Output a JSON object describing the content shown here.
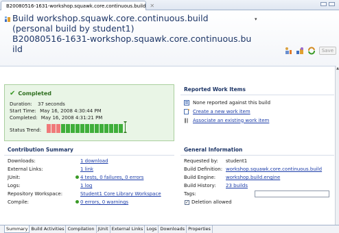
{
  "editor_tab": {
    "label": "B20080516-1631-workshop.squawk.core.continuous.build",
    "close_glyph": "✕"
  },
  "header": {
    "title_line1": "Build workshop.squawk.core.continuous.build",
    "title_line2": "(personal build by student1)",
    "title_line3": "B20080516-1631-workshop.squawk.core.continuous.bu",
    "title_line4": "ild",
    "menu_glyph": "▾",
    "save_label": "Save"
  },
  "status": {
    "title": "Completed",
    "duration_label": "Duration:",
    "duration_value": "37 seconds",
    "start_label": "Start Time:",
    "start_value": "May 16, 2008 4:30:44 PM",
    "completed_label": "Completed:",
    "completed_value": "May 16, 2008 4:31:21 PM",
    "trend_label": "Status Trend:",
    "trend": [
      "failed",
      "failed",
      "failed",
      "ok",
      "ok",
      "ok",
      "ok",
      "ok",
      "ok",
      "ok",
      "ok",
      "ok",
      "ok",
      "ok",
      "ok",
      "ok"
    ]
  },
  "reported": {
    "heading": "Reported Work Items",
    "none_text": "None reported against this build",
    "create_link": "Create a new work item",
    "associate_link": "Associate an existing work item"
  },
  "contribution": {
    "heading": "Contribution Summary",
    "rows": [
      {
        "label": "Downloads:",
        "value": "1 download",
        "status": false
      },
      {
        "label": "External Links:",
        "value": "1 link",
        "status": false
      },
      {
        "label": "JUnit:",
        "value": "4 tests, 0 failures, 0 errors",
        "status": true
      },
      {
        "label": "Logs:",
        "value": "1 log",
        "status": false
      },
      {
        "label": "Repository Workspace:",
        "value": "Student1 Core Library Workspace",
        "status": false
      },
      {
        "label": "Compile:",
        "value": "0 errors, 0 warnings",
        "status": true
      }
    ]
  },
  "general": {
    "heading": "General Information",
    "requested_label": "Requested by:",
    "requested_value": "student1",
    "definition_label": "Build Definition:",
    "definition_value": "workshop.squawk.core.continuous.build",
    "engine_label": "Build Engine:",
    "engine_value": "workshop.build.engine",
    "history_label": "Build History:",
    "history_value": "23 builds",
    "tags_label": "Tags:",
    "tags_value": "",
    "deletion_label": "Deletion allowed",
    "deletion_checked": true,
    "check_glyph": "✓"
  },
  "page_tabs": [
    "Summary",
    "Build Activities",
    "Compilation",
    "JUnit",
    "External Links",
    "Logs",
    "Downloads",
    "Properties"
  ],
  "active_page_tab": 0,
  "colors": {
    "completed_bg": "#e9f5e6",
    "trend_failed": "#f07a7a",
    "trend_ok": "#3fae3a",
    "link": "#1a3ba8"
  }
}
